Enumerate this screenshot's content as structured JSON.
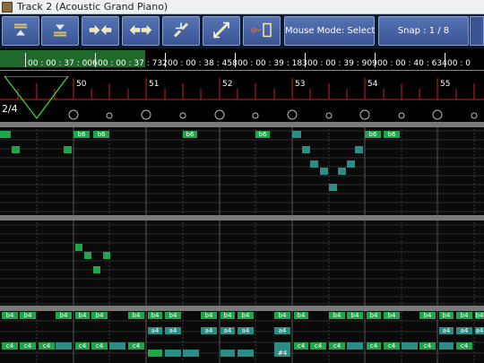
{
  "window": {
    "title": "Track 2 (Acoustic Grand Piano)"
  },
  "toolbar": {
    "buttons": [
      {
        "name": "collapse-top-button",
        "icon": "⏏"
      },
      {
        "name": "collapse-bottom-button",
        "icon": "⏷"
      },
      {
        "name": "zoom-in-horizontal-button",
        "icon": "⇨⇦"
      },
      {
        "name": "zoom-out-horizontal-button",
        "icon": "⇦⇨"
      },
      {
        "name": "zoom-in-vertical-button",
        "icon": "⇅"
      },
      {
        "name": "zoom-out-vertical-button",
        "icon": "⇵"
      },
      {
        "name": "loop-button",
        "icon": "⟲▯"
      }
    ],
    "mouse_mode_label": "Mouse Mode: Select",
    "snap_label": "Snap : 1 / 8"
  },
  "timeline": {
    "timecodes": [
      "00 : 00 : 37 : 006",
      "00 : 00 : 37 : 732",
      "00 : 00 : 38 : 458",
      "00 : 00 : 39 : 183",
      "00 : 00 : 39 : 909",
      "00 : 00 : 40 : 634",
      "00 : 0"
    ],
    "bars": [
      "50",
      "51",
      "52",
      "53",
      "54",
      "55"
    ],
    "time_signature": "2/4"
  },
  "notes": {
    "top_labels": [
      "b6",
      "b6",
      "b6",
      "b6",
      "b6",
      "b6"
    ],
    "bottom_labels": [
      "b4",
      "b4",
      "b4",
      "b4",
      "b4",
      "b4",
      "b4",
      "b4",
      "b4",
      "b4",
      "b4",
      "b4",
      "b4",
      "b4",
      "b4",
      "b4",
      "b4",
      "b4",
      "b4",
      "b4",
      "b4",
      "b4",
      "b4",
      "b4",
      "b4"
    ],
    "a4_labels": [
      "a4",
      "a4",
      "a4",
      "a4",
      "a4",
      "a4",
      "a4",
      "a4",
      "a4",
      "a4",
      "a4",
      "a4"
    ],
    "c4_labels": [
      "c4",
      "c4",
      "c4",
      "c4",
      "c4",
      "c4",
      "c4",
      "c4",
      "c4",
      "c4",
      "c4",
      "c4",
      "c4",
      "c4",
      "c4",
      "c4",
      "c4",
      "c4"
    ],
    "sharp_label": "#4"
  },
  "colors": {
    "note_green": "#1fa64a",
    "note_teal": "#2a8e86",
    "ruler_red": "#cc2222",
    "loop_green": "#1f6a2a"
  }
}
